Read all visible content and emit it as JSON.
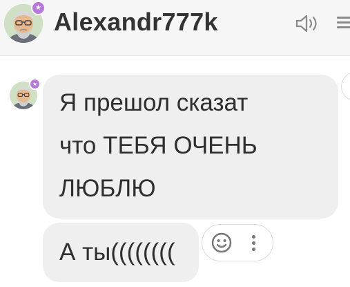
{
  "header": {
    "contact_name": "Alexandr777k",
    "avatar_icon": "avatar-old-man-glasses-beard",
    "presence_badge_icon": "star-badge-icon",
    "speaker_icon": "speaker-icon",
    "menu_icon": "hamburger-menu-icon"
  },
  "messages": [
    {
      "sender": "Alexandr777k",
      "lines": [
        "Я прешол сказат",
        "что ТЕБЯ ОЧЕНЬ",
        "ЛЮБЛЮ"
      ]
    },
    {
      "sender": "Alexandr777k",
      "text": "А ты(((((((("
    }
  ],
  "message_actions": {
    "emoji_icon": "smiley-icon",
    "more_icon": "more-vertical-icon"
  },
  "colors": {
    "header_bg": "#f6f6f6",
    "bubble_bg": "#efefef",
    "text": "#2f2f2f",
    "presence_badge": "#b57ad9",
    "icon_gray": "#8a8a8a"
  }
}
